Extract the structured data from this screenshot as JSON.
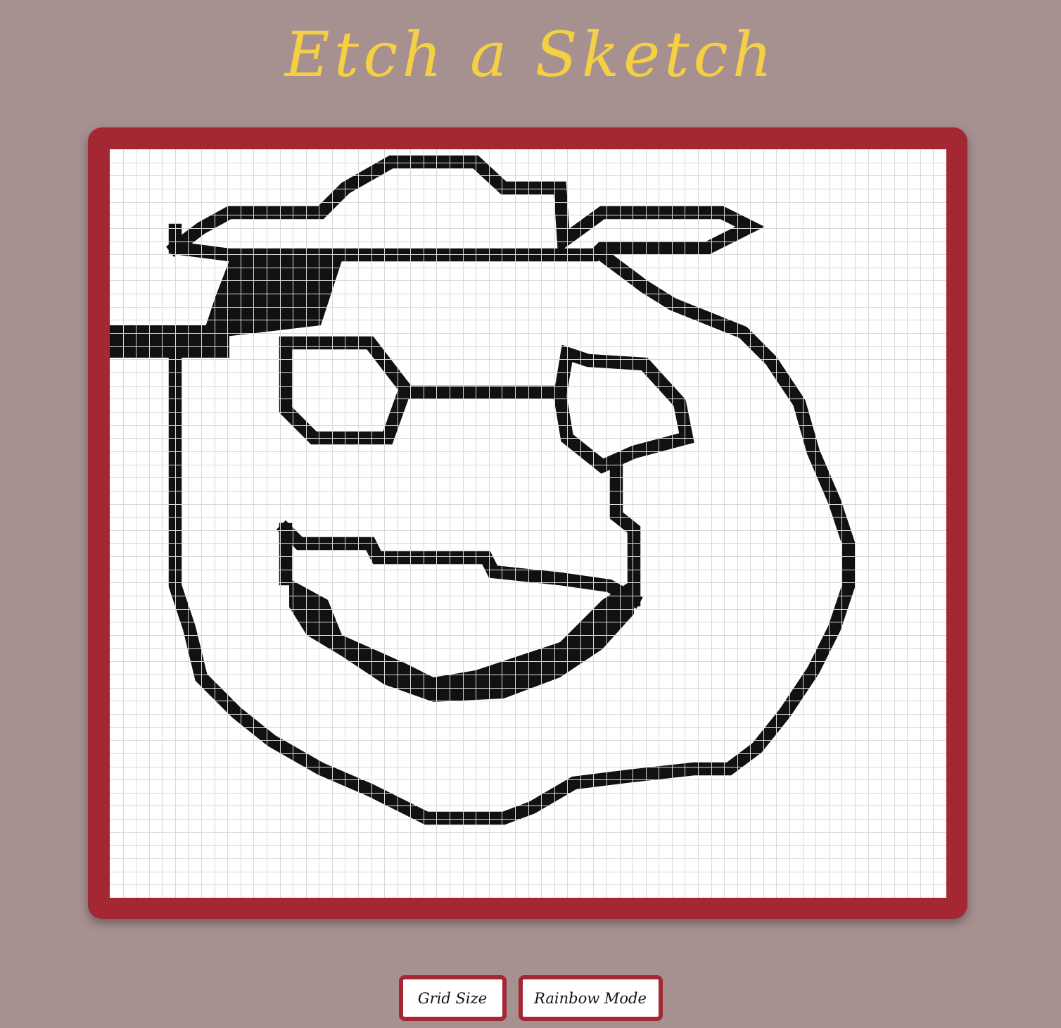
{
  "header": {
    "title": "Etch a Sketch"
  },
  "sketch": {
    "columns": 64,
    "rows": 57,
    "pen_color": "#111111",
    "grid_line_color": "#d9d9d9",
    "background_color": "#ffffff",
    "frame_color": "#a42734"
  },
  "controls": {
    "grid_size_label": "Grid Size",
    "rainbow_mode_label": "Rainbow Mode"
  },
  "colors": {
    "page_background": "#a79190",
    "title": "#f5cf44",
    "frame": "#a42734"
  }
}
